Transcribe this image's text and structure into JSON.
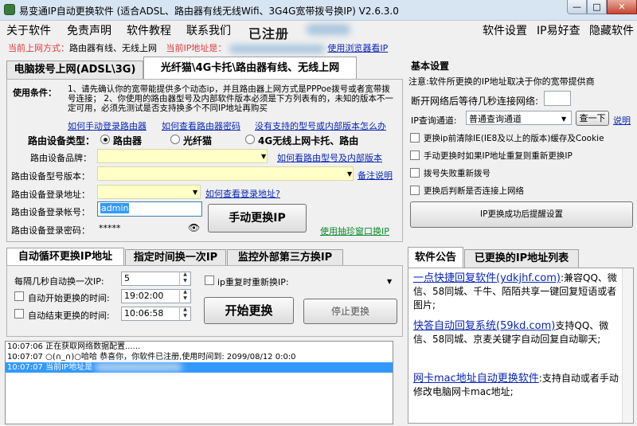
{
  "window": {
    "title": "易变通IP自动更换软件 (适合ADSL、路由器有线无线Wifi、3G4G宽带拨号换IP) V2.6.3.0",
    "min": "—",
    "max": "□",
    "close": "✕"
  },
  "menu": {
    "items": [
      "关于软件",
      "免责声明",
      "软件教程",
      "联系我们"
    ],
    "registered": "已注册",
    "right": [
      "软件设置",
      "IP易好查",
      "隐藏软件"
    ]
  },
  "status": {
    "mode_label": "当前上网方式：",
    "mode_value": "路由器有线、无线上网",
    "ip_label": "当前IP地址是：",
    "ip_link": "使用浏览器看IP"
  },
  "tabs_top": [
    "电脑拨号上网(ADSL\\3G)",
    "光纤猫\\4G卡托\\路由器有线、无线上网"
  ],
  "usage": {
    "label": "使用条件：",
    "text": "1、请先确认你的宽带能提供多个动态ip，并且路由器上网方式是PPPoe拨号或者宽带拨号连接； 2、你使用的路由器型号及内部软件版本必须是下方列表有的，未知的版本不一定可用，必须先测试是否支持换多个不同IP地址再购买",
    "link1": "如何手动登录路由器",
    "link2": "如何查看路由器密码",
    "link3": "没有支持的型号或内部版本怎么办"
  },
  "device_type": {
    "label": "路由设备类型：",
    "options": [
      "路由器",
      "光纤猫",
      "4G无线上网卡托、路由"
    ],
    "selected": 0
  },
  "form": {
    "brand_label": "路由设备品牌：",
    "brand_link": "如何看路由型号及内部版本",
    "model_label": "路由设备型号版本：",
    "model_link": "备注说明",
    "addr_label": "路由设备登录地址：",
    "addr_link": "如何查看登录地址?",
    "user_label": "路由设备登录帐号：",
    "user_value": "admin",
    "pass_label": "路由设备登录密码：",
    "pass_value": "*****",
    "manual_button": "手动更换IP",
    "popup_link": "使用抽珍窗口换IP"
  },
  "basic": {
    "title": "基本设置",
    "desc": "注意:软件所更换的IP地址取决于你的宽带提供商",
    "reconnect_label": "断开网络后等待几秒连接网络:",
    "reconnect_value": "",
    "ipquery_label": "IP查询通道:",
    "ipquery_value": "普通查询通道",
    "check_button": "查一下",
    "explain_link": "说明",
    "checks": [
      "更换ip前清除IE(IE8及以上的版本)缓存及Cookie",
      "手动更换时如果IP地址重复则重新更换IP",
      "拨号失败重新拨号",
      "更换后判断是否连接上网络"
    ],
    "remind_button": "IP更换成功后提醒设置"
  },
  "tabs_bottom": [
    "自动循环更换IP地址",
    "指定时间换一次IP",
    "监控外部第三方换IP"
  ],
  "auto": {
    "interval_label": "每隔几秒自动换一次IP:",
    "interval_value": "5",
    "start_label": "自动开始更换的时间:",
    "start_value": "19:02:00",
    "end_label": "自动结束更换的时间:",
    "end_value": "10:06:58",
    "repeat_label": "ip重复时重新换IP:",
    "start_button": "开始更换",
    "stop_button": "停止更换"
  },
  "log": [
    {
      "time": "10:07:06",
      "text": "正在获取网络数据配置......"
    },
    {
      "time": "10:07:07",
      "text": "○(∩_∩)○哈哈 恭喜你，你软件已注册,使用时间到: 2099/08/12 0:0:0"
    },
    {
      "time": "10:07:07",
      "text": "当前IP地址是"
    }
  ],
  "tabs_right": [
    "软件公告",
    "已更换的IP地址列表"
  ],
  "notices": [
    {
      "link": "一点快捷回复软件(ydkjhf.com)",
      "text": ":兼容QQ、微信、58同城、千牛、陌陌共享一键回复短语或者图片;"
    },
    {
      "link": "快答自动回复系统(59kd.com)",
      "text": "支持QQ、微信、58同城、京麦关键字自动回复自动聊天;"
    },
    {
      "link": "网卡mac地址自动更换软件",
      "text": ":支持自动或者手动修改电脑网卡mac地址;"
    }
  ],
  "colors": {
    "link": "#0a26b8",
    "status_red": "#e23a3a",
    "selection": "#3399ff"
  }
}
